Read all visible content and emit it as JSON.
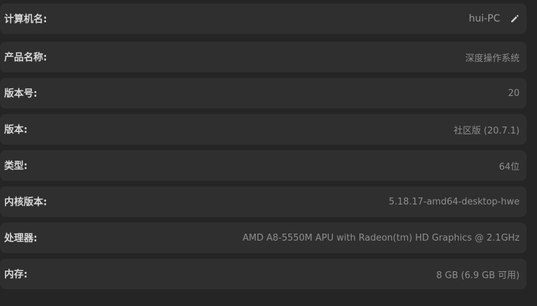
{
  "rows": [
    {
      "label": "计算机名:",
      "value": "hui-PC"
    },
    {
      "label": "产品名称:",
      "value": "深度操作系统"
    },
    {
      "label": "版本号:",
      "value": "20"
    },
    {
      "label": "版本:",
      "value": "社区版 (20.7.1)"
    },
    {
      "label": "类型:",
      "value": "64位"
    },
    {
      "label": "内核版本:",
      "value": "5.18.17-amd64-desktop-hwe"
    },
    {
      "label": "处理器:",
      "value": "AMD A8-5550M APU with Radeon(tm) HD Graphics @ 2.1GHz"
    },
    {
      "label": "内存:",
      "value": "8 GB (6.9 GB 可用)"
    }
  ],
  "icons": {
    "hostname_edit": "pencil-icon"
  },
  "colors": {
    "background": "#252525",
    "row_background": "#2f2f2f",
    "label_text": "#d6d6d6",
    "value_text": "#8e8e8e"
  }
}
